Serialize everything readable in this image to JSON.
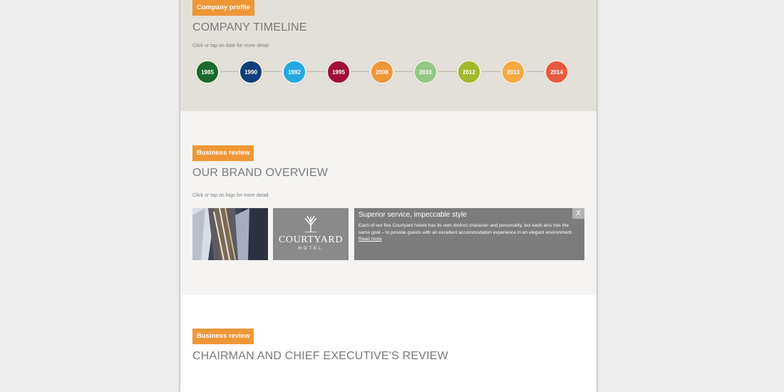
{
  "company_profile": {
    "tag": "Company profile",
    "heading": "COMPANY TIMELINE",
    "hint": "Click or tap on date for more detail",
    "years": [
      {
        "label": "1985",
        "color": "#1a6a31"
      },
      {
        "label": "1990",
        "color": "#113e7c"
      },
      {
        "label": "1992",
        "color": "#27a8e0"
      },
      {
        "label": "1995",
        "color": "#a01038"
      },
      {
        "label": "2008",
        "color": "#ef9637"
      },
      {
        "label": "2010",
        "color": "#94c886"
      },
      {
        "label": "2012",
        "color": "#a1ba2d"
      },
      {
        "label": "2013",
        "color": "#f5a941"
      },
      {
        "label": "2014",
        "color": "#e9593f"
      }
    ]
  },
  "brand_overview": {
    "tag": "Business review",
    "heading": "OUR BRAND OVERVIEW",
    "hint": "Click or tap on logo for more detail",
    "logo_word": "COURTYARD",
    "logo_sub": "HOTEL",
    "info": {
      "title": "Superior service, impeccable style",
      "body": "Each of our five Courtyard hotels has its own distinct character and personality, but each also has the same goal – to provide guests with an excellent accommodation experience in an elegant environment.",
      "link": "Read more",
      "close": "X"
    }
  },
  "review": {
    "tag": "Business review",
    "heading": "CHAIRMAN AND CHIEF EXECUTIVE'S REVIEW"
  }
}
